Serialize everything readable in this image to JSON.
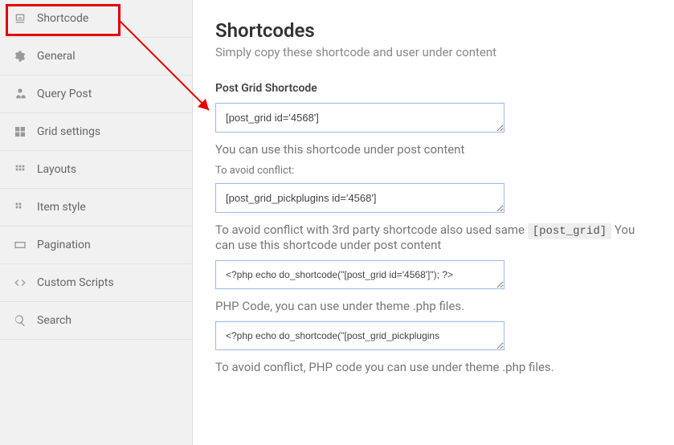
{
  "sidebar": {
    "items": [
      {
        "label": "Shortcode"
      },
      {
        "label": "General"
      },
      {
        "label": "Query Post"
      },
      {
        "label": "Grid settings"
      },
      {
        "label": "Layouts"
      },
      {
        "label": "Item style"
      },
      {
        "label": "Pagination"
      },
      {
        "label": "Custom Scripts"
      },
      {
        "label": "Search"
      }
    ]
  },
  "main": {
    "title": "Shortcodes",
    "subtitle": "Simply copy these shortcode and user under content",
    "sectionLabel": "Post Grid Shortcode",
    "shortcode1": "[post_grid id='4568']",
    "hint1": "You can use this shortcode under post content",
    "avoidConflictLabel": "To avoid conflict:",
    "shortcode2": "[post_grid_pickplugins id='4568']",
    "hint2Prefix": "To avoid conflict with 3rd party shortcode also used same ",
    "inlineCode": "[post_grid]",
    "hint2Suffix": " You can use this shortcode under post content",
    "php1": "<?php echo do_shortcode(\"[post_grid id='4568']\"); ?>",
    "hint3": "PHP Code, you can use under theme .php files.",
    "php2": "<?php echo do_shortcode(\"[post_grid_pickplugins",
    "hint4": "To avoid conflict, PHP code you can use under theme .php files."
  }
}
